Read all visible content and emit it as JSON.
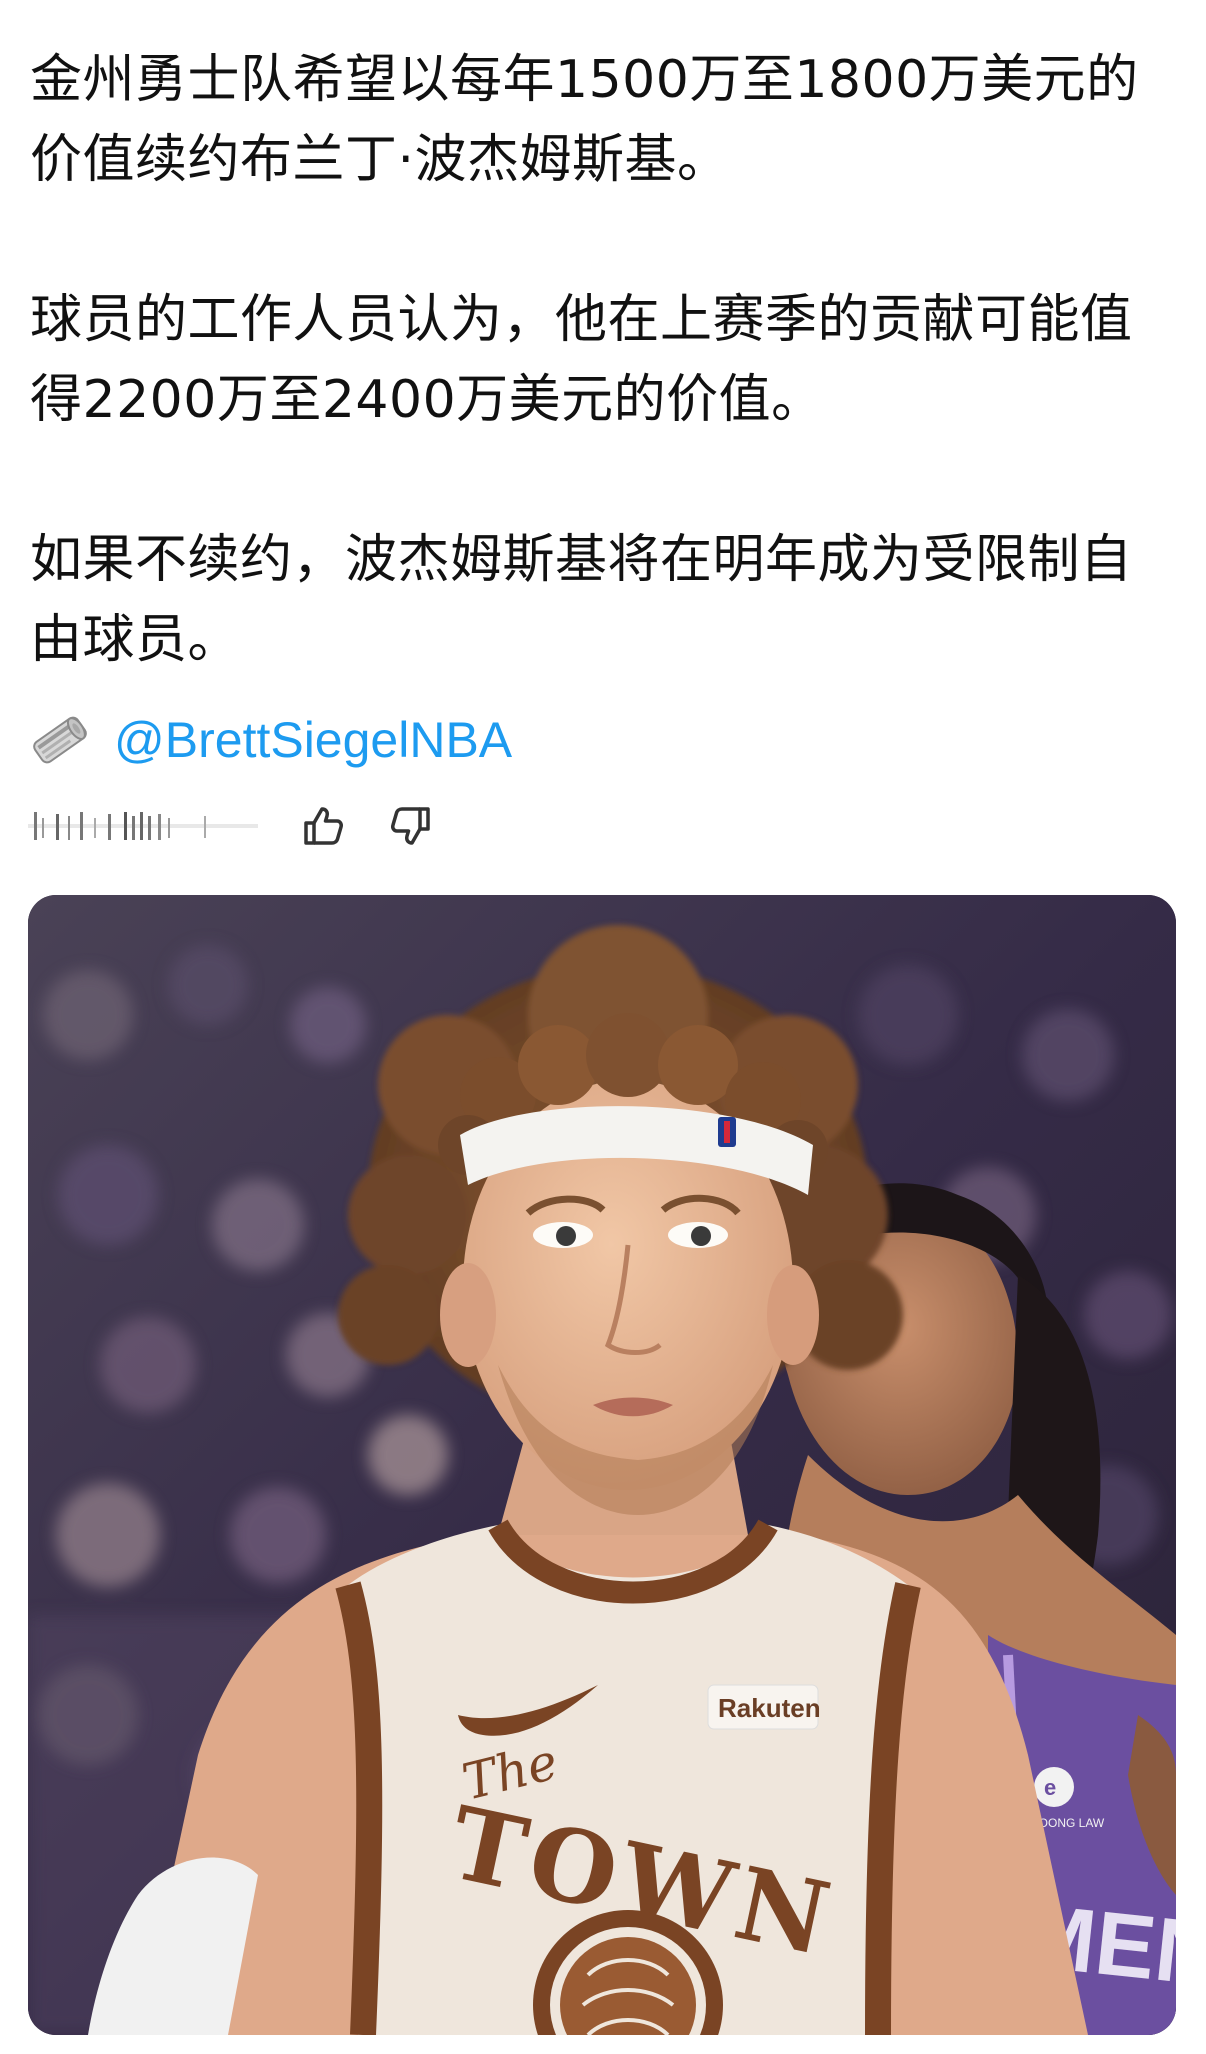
{
  "post": {
    "paragraphs": [
      "金州勇士队希望以每年1500万至1800万美元的价值续约布兰丁·波杰姆斯基。",
      "球员的工作人员认为，他在上赛季的贡献可能值得2200万至2400万美元的价值。",
      "如果不续约，波杰姆斯基将在明年成为受限制自由球员。"
    ],
    "source": {
      "icon": "newspaper-icon",
      "handle": "@BrettSiegelNBA"
    },
    "actions": {
      "like_icon": "thumbs-up-icon",
      "dislike_icon": "thumbs-down-icon"
    },
    "photo": {
      "jersey_sponsor": "Rakuten",
      "jersey_script": "The",
      "jersey_word": "TOWN",
      "opponent_text": "MENTO",
      "opponent_patch": "PHOONG LAW"
    }
  },
  "colors": {
    "link": "#1d9bf0",
    "text": "#111111",
    "jersey_trim": "#7a4424",
    "jersey_base": "#efe6dc",
    "opponent_purple": "#6b4fa0"
  }
}
